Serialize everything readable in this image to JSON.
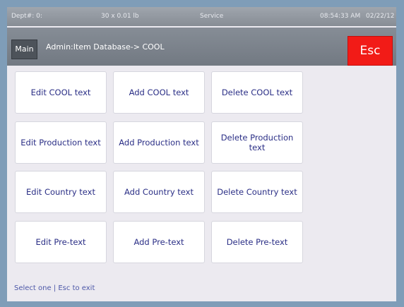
{
  "status": {
    "dept": "Dept#: 0:",
    "weight": "30 x 0.01 lb",
    "mode": "Service",
    "time": "08:54:33 AM",
    "date": "02/22/12"
  },
  "header": {
    "main_label": "Main",
    "breadcrumb": "Admin:Item Database-> COOL",
    "esc_label": "Esc"
  },
  "tiles": [
    [
      "Edit COOL text",
      "Add COOL text",
      "Delete COOL text"
    ],
    [
      "Edit Production text",
      "Add Production text",
      "Delete Production text"
    ],
    [
      "Edit Country text",
      "Add Country text",
      "Delete Country text"
    ],
    [
      "Edit Pre-text",
      "Add Pre-text",
      "Delete Pre-text"
    ]
  ],
  "footer": {
    "hint": "Select one | Esc to exit"
  },
  "colors": {
    "esc": "#f21b17",
    "tile_text": "#2b2f86",
    "hint_text": "#4d58a8"
  }
}
